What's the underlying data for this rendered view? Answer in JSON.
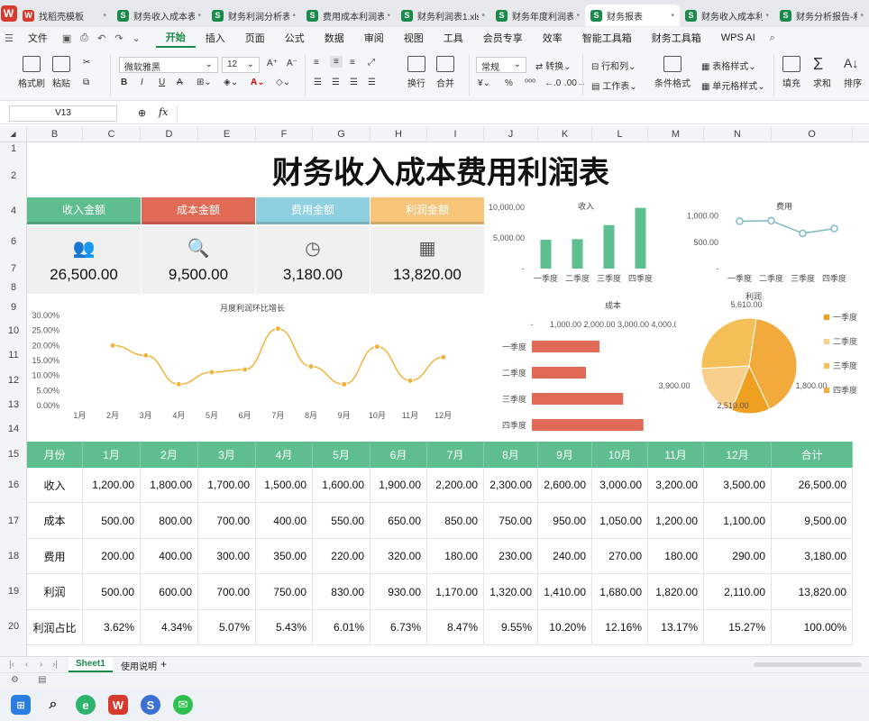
{
  "tabs": [
    {
      "label": "找稻壳模板",
      "icon": "wps-template-icon",
      "color": "#d63b2f"
    },
    {
      "label": "财务收入成本表",
      "icon": "spreadsheet-icon",
      "color": "#1a8a4a"
    },
    {
      "label": "财务利润分析表",
      "icon": "spreadsheet-icon",
      "color": "#1a8a4a"
    },
    {
      "label": "费用成本利润表",
      "icon": "spreadsheet-icon",
      "color": "#1a8a4a"
    },
    {
      "label": "财务利润表1.xlsx",
      "icon": "spreadsheet-icon",
      "color": "#1a8a4a"
    },
    {
      "label": "财务年度利润表1.x",
      "icon": "spreadsheet-icon",
      "color": "#1a8a4a"
    },
    {
      "label": "财务报表",
      "icon": "spreadsheet-icon",
      "color": "#1a8a4a"
    },
    {
      "label": "财务收入成本利润",
      "icon": "spreadsheet-icon",
      "color": "#1a8a4a"
    },
    {
      "label": "财务分析报告-利润",
      "icon": "spreadsheet-icon",
      "color": "#1a8a4a"
    }
  ],
  "menu": {
    "file": "文件",
    "items": [
      "开始",
      "插入",
      "页面",
      "公式",
      "数据",
      "审阅",
      "视图",
      "工具",
      "会员专享",
      "效率",
      "智能工具箱",
      "财务工具箱",
      "WPS AI"
    ]
  },
  "ribbon": {
    "format_painter": "格式刷",
    "paste": "粘贴",
    "font_name": "微软雅黑",
    "font_size": "12",
    "wrap": "换行",
    "merge": "合并",
    "number_format": "常规",
    "convert": "转换",
    "row_col": "行和列",
    "worksheet": "工作表",
    "cond_format": "条件格式",
    "table_style": "表格样式",
    "cell_style": "单元格样式",
    "fill": "填充",
    "sum": "求和",
    "sort": "排序"
  },
  "formula": {
    "cell_ref": "V13",
    "fx": "fx"
  },
  "columns": [
    "B",
    "C",
    "D",
    "E",
    "F",
    "G",
    "H",
    "I",
    "J",
    "K",
    "L",
    "M",
    "N",
    "O"
  ],
  "rows": [
    "1",
    "2",
    "4",
    "6",
    "7",
    "8",
    "9",
    "10",
    "11",
    "12",
    "13",
    "14",
    "15",
    "16",
    "17",
    "18",
    "19",
    "20"
  ],
  "title": "财务收入成本费用利润表",
  "kpis": [
    {
      "label": "收入金额",
      "value": "26,500.00",
      "color": "#5fbe8f",
      "icon": "money-person-icon"
    },
    {
      "label": "成本金额",
      "value": "9,500.00",
      "color": "#e06a55",
      "icon": "magnifier-coin-icon"
    },
    {
      "label": "费用金额",
      "value": "3,180.00",
      "color": "#8fd0e0",
      "icon": "clock-coin-icon"
    },
    {
      "label": "利润金额",
      "value": "13,820.00",
      "color": "#f6c57a",
      "icon": "chart-screen-icon"
    }
  ],
  "chart_data": [
    {
      "type": "bar",
      "title": "收入",
      "categories": [
        "一季度",
        "二季度",
        "三季度",
        "四季度"
      ],
      "values": [
        4700,
        4800,
        7100,
        9900
      ],
      "ylim": [
        0,
        10000
      ],
      "yticks": [
        "10,000.00",
        "5,000.00",
        "-"
      ],
      "color": "#5fbe8f"
    },
    {
      "type": "line",
      "title": "费用",
      "categories": [
        "一季度",
        "二季度",
        "三季度",
        "四季度"
      ],
      "values": [
        900,
        910,
        670,
        760
      ],
      "ylim": [
        0,
        1200
      ],
      "yticks": [
        "1,000.00",
        "500.00",
        "-"
      ],
      "color": "#7fb8c7"
    },
    {
      "type": "bar",
      "orientation": "horizontal",
      "title": "成本",
      "categories": [
        "一季度",
        "二季度",
        "三季度",
        "四季度"
      ],
      "values": [
        2000,
        1600,
        2700,
        3300
      ],
      "xticks": [
        "-",
        "1,000.00",
        "2,000.00",
        "3,000.00",
        "4,000.00"
      ],
      "xlim": [
        0,
        4000
      ],
      "color": "#e06a55"
    },
    {
      "type": "pie",
      "title": "利润",
      "labels": [
        "一季度",
        "二季度",
        "三季度",
        "四季度"
      ],
      "values": [
        1800,
        2510,
        3900,
        5610
      ],
      "data_labels": [
        "1,800.00",
        "2,510.00",
        "3,900.00",
        "5,610.00"
      ],
      "colors": [
        "#f0a020",
        "#f9d08b",
        "#f5bf58",
        "#f3aa3c"
      ],
      "legend": "right"
    },
    {
      "type": "line",
      "title": "月度利润环比增长",
      "categories": [
        "1月",
        "2月",
        "3月",
        "4月",
        "5月",
        "6月",
        "7月",
        "8月",
        "9月",
        "10月",
        "11月",
        "12月"
      ],
      "values": [
        null,
        20.0,
        16.7,
        7.1,
        11.1,
        12.0,
        25.6,
        13.0,
        7.1,
        19.6,
        8.3,
        16.1
      ],
      "ylim": [
        0,
        30
      ],
      "yticks": [
        "30.00%",
        "25.00%",
        "20.00%",
        "15.00%",
        "10.00%",
        "5.00%",
        "0.00%"
      ],
      "color": "#f3b23a"
    }
  ],
  "table": {
    "header": [
      "月份",
      "1月",
      "2月",
      "3月",
      "4月",
      "5月",
      "6月",
      "7月",
      "8月",
      "9月",
      "10月",
      "11月",
      "12月",
      "合计"
    ],
    "rows": [
      [
        "收入",
        "1,200.00",
        "1,800.00",
        "1,700.00",
        "1,500.00",
        "1,600.00",
        "1,900.00",
        "2,200.00",
        "2,300.00",
        "2,600.00",
        "3,000.00",
        "3,200.00",
        "3,500.00",
        "26,500.00"
      ],
      [
        "成本",
        "500.00",
        "800.00",
        "700.00",
        "400.00",
        "550.00",
        "650.00",
        "850.00",
        "750.00",
        "950.00",
        "1,050.00",
        "1,200.00",
        "1,100.00",
        "9,500.00"
      ],
      [
        "费用",
        "200.00",
        "400.00",
        "300.00",
        "350.00",
        "220.00",
        "320.00",
        "180.00",
        "230.00",
        "240.00",
        "270.00",
        "180.00",
        "290.00",
        "3,180.00"
      ],
      [
        "利润",
        "500.00",
        "600.00",
        "700.00",
        "750.00",
        "830.00",
        "930.00",
        "1,170.00",
        "1,320.00",
        "1,410.00",
        "1,680.00",
        "1,820.00",
        "2,110.00",
        "13,820.00"
      ],
      [
        "利润占比",
        "3.62%",
        "4.34%",
        "5.07%",
        "5.43%",
        "6.01%",
        "6.73%",
        "8.47%",
        "9.55%",
        "10.20%",
        "12.16%",
        "13.17%",
        "15.27%",
        "100.00%"
      ]
    ]
  },
  "sheets": [
    "Sheet1",
    "使用说明"
  ],
  "taskbar": [
    "windows-start-icon",
    "search-icon",
    "edge-browser-icon",
    "wps-office-icon",
    "sogou-icon",
    "wechat-icon"
  ]
}
